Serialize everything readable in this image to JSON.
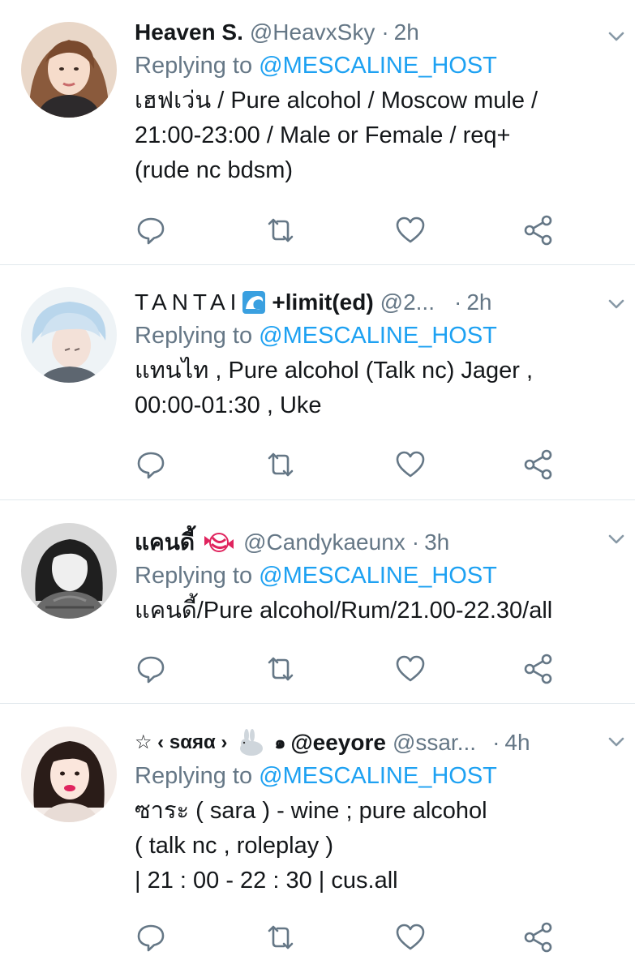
{
  "colors": {
    "link": "#1da1f2",
    "secondary": "#657786",
    "primary_text": "#14171a",
    "divider": "#e1e8ed"
  },
  "tweets": [
    {
      "name": "Heaven S.",
      "handle": "@HeavxSky",
      "dot": "·",
      "time": "2h",
      "replying_prefix": "Replying to ",
      "replying_handle": "@MESCALINE_HOST",
      "lines": [
        "เฮฟเว่น / Pure alcohol / Moscow mule /",
        "21:00-23:00 / Male or Female / req+",
        "(rude nc bdsm)"
      ],
      "avatar_icon": "avatar-photo"
    },
    {
      "name": "TANTAI",
      "name_suffix": "+limit(ed)",
      "name_emoji": "wave-emoji",
      "handle": "@2...",
      "dot": "·",
      "time": "2h",
      "replying_prefix": "Replying to ",
      "replying_handle": "@MESCALINE_HOST",
      "lines": [
        "แทนไท , Pure alcohol (Talk nc) Jager ,",
        "00:00-01:30 , Uke"
      ],
      "avatar_icon": "avatar-photo"
    },
    {
      "name": "แคนดี้",
      "name_emoji": "candy-emoji",
      "handle": "@Candykaeunx",
      "dot": "·",
      "time": "3h",
      "replying_prefix": "Replying to ",
      "replying_handle": "@MESCALINE_HOST",
      "lines": [
        "แคนดี้/Pure alcohol/Rum/21.00-22.30/all"
      ],
      "avatar_icon": "avatar-photo"
    },
    {
      "name_prefix": "☆ ‹ sαяα ›",
      "name_emoji": "rabbit-emoji",
      "name_spiral": "๑",
      "name": "@eeyore",
      "handle": "@ssar...",
      "dot": "·",
      "time": "4h",
      "replying_prefix": "Replying to ",
      "replying_handle": "@MESCALINE_HOST",
      "lines": [
        "ซาระ ( sara ) - wine ; pure alcohol",
        "( talk nc , roleplay )",
        "| 21 : 00 - 22 : 30 | cus.all"
      ],
      "avatar_icon": "avatar-photo"
    }
  ],
  "icons": {
    "reply": "reply-icon",
    "retweet": "retweet-icon",
    "like": "heart-icon",
    "share": "share-icon",
    "menu": "chevron-down-icon"
  }
}
